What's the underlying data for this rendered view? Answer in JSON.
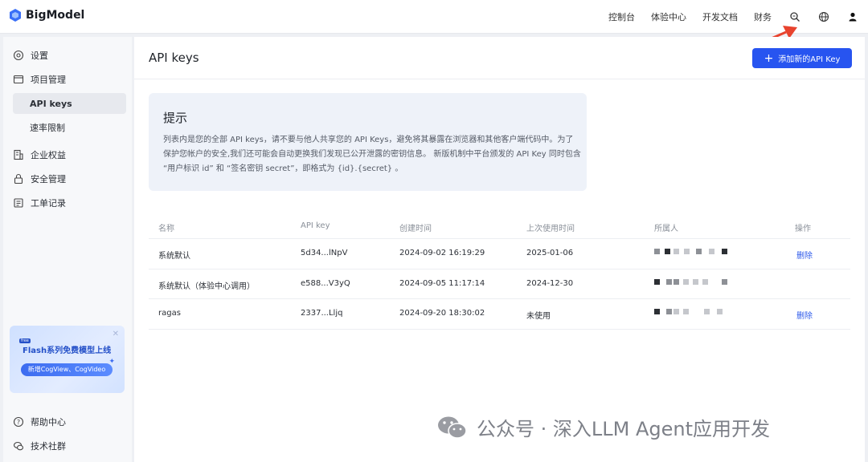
{
  "brand": {
    "name": "BigModel"
  },
  "topnav": {
    "items": [
      "控制台",
      "体验中心",
      "开发文档",
      "财务"
    ],
    "icons": [
      "search-key-icon",
      "globe-icon",
      "user-icon"
    ]
  },
  "sidebar": {
    "items": [
      {
        "label": "设置",
        "icon": "settings-icon"
      },
      {
        "label": "项目管理",
        "icon": "project-icon"
      },
      {
        "label": "API keys"
      },
      {
        "label": "速率限制"
      },
      {
        "label": "企业权益",
        "icon": "enterprise-icon"
      },
      {
        "label": "安全管理",
        "icon": "lock-icon"
      },
      {
        "label": "工单记录",
        "icon": "ticket-icon"
      }
    ],
    "footer": [
      {
        "label": "帮助中心",
        "icon": "help-icon"
      },
      {
        "label": "技术社群",
        "icon": "community-icon"
      }
    ],
    "promo": {
      "badge": "free",
      "title": "Flash系列免费模型上线",
      "subtitle": "新增CogView、CogVideo"
    }
  },
  "main": {
    "title": "API keys",
    "add_button": "添加新的API Key",
    "tip": {
      "title": "提示",
      "body": "列表内是您的全部 API keys，请不要与他人共享您的 API Keys，避免将其暴露在浏览器和其他客户端代码中。为了保护您帐户的安全,我们还可能会自动更换我们发现已公开泄露的密钥信息。 新版机制中平台颁发的 API Key 同时包含 “用户标识 id” 和 “签名密钥 secret”，即格式为 {id}.{secret} 。"
    },
    "table": {
      "headers": [
        "名称",
        "API key",
        "创建时间",
        "上次使用时间",
        "所属人",
        "操作"
      ],
      "rows": [
        {
          "name": "系统默认",
          "key": "5d34...lNpV",
          "created": "2024-09-02 16:19:29",
          "last_used": "2025-01-06",
          "action": "删除"
        },
        {
          "name": "系统默认（体验中心调用）",
          "key": "e588...V3yQ",
          "created": "2024-09-05 11:17:14",
          "last_used": "2024-12-30",
          "action": ""
        },
        {
          "name": "ragas",
          "key": "2337...Lljq",
          "created": "2024-09-20 18:30:02",
          "last_used": "未使用",
          "action": "删除"
        }
      ]
    }
  },
  "watermark": "公众号 · 深入LLM Agent应用开发",
  "colors": {
    "accent": "#2754f0",
    "arrow": "#e8432e"
  }
}
